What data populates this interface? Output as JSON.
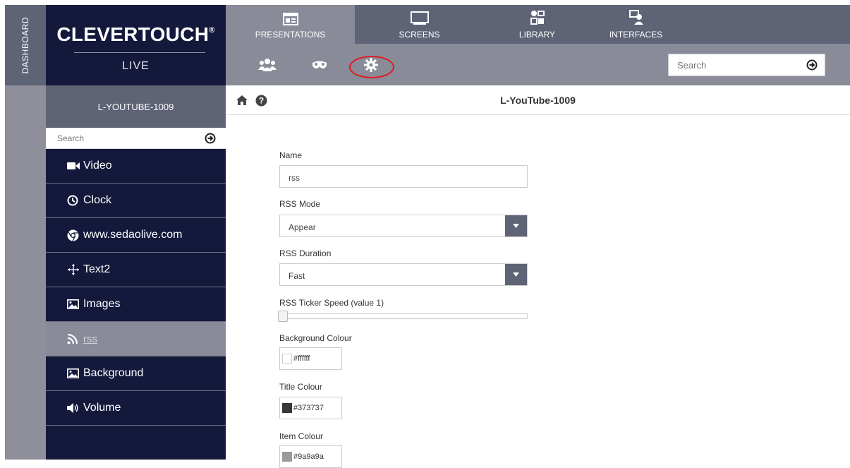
{
  "dashboard": {
    "label": "DASHBOARD"
  },
  "logo": {
    "main": "CLEVERTOUCH",
    "reg": "®",
    "sub": "LIVE"
  },
  "top_nav": {
    "tabs": [
      {
        "label": "PRESENTATIONS",
        "icon": "presentation-icon",
        "active": true
      },
      {
        "label": "SCREENS",
        "icon": "monitor-icon",
        "active": false
      },
      {
        "label": "LIBRARY",
        "icon": "media-library-icon",
        "active": false
      },
      {
        "label": "INTERFACES",
        "icon": "interface-icon",
        "active": false
      }
    ]
  },
  "sub_nav": {
    "icons": [
      "users-icon",
      "mask-icon",
      "gear-icon"
    ],
    "highlighted": "gear-icon",
    "search_placeholder": "Search"
  },
  "left_panel": {
    "title": "L-YOUTUBE-1009",
    "search_placeholder": "Search",
    "items": [
      {
        "label": "Video",
        "icon": "video-camera-icon",
        "active": false
      },
      {
        "label": "Clock",
        "icon": "clock-icon",
        "active": false
      },
      {
        "label": "www.sedaolive.com",
        "icon": "chrome-icon",
        "active": false
      },
      {
        "label": "Text2",
        "icon": "move-arrows-icon",
        "active": false
      },
      {
        "label": "Images",
        "icon": "image-icon",
        "active": false
      },
      {
        "label": "rss",
        "icon": "rss-icon",
        "active": true
      },
      {
        "label": "Background",
        "icon": "image-icon",
        "active": false
      },
      {
        "label": "Volume",
        "icon": "volume-icon",
        "active": false
      }
    ]
  },
  "content": {
    "title": "L-YouTube-1009",
    "form": {
      "name_label": "Name",
      "name_value": "rss",
      "rss_mode_label": "RSS Mode",
      "rss_mode_value": "Appear",
      "rss_duration_label": "RSS Duration",
      "rss_duration_value": "Fast",
      "ticker_speed_label": "RSS Ticker Speed (value 1)",
      "ticker_speed_value": 1,
      "bg_colour_label": "Background Colour",
      "bg_colour_value": "#ffffff",
      "title_colour_label": "Title Colour",
      "title_colour_value": "#373737",
      "item_colour_label": "Item Colour",
      "item_colour_value": "#9a9a9a"
    }
  },
  "colors": {
    "navy": "#14193c",
    "slate": "#5f6376",
    "grey": "#8a8b98",
    "highlight_ring": "#e01b22"
  }
}
